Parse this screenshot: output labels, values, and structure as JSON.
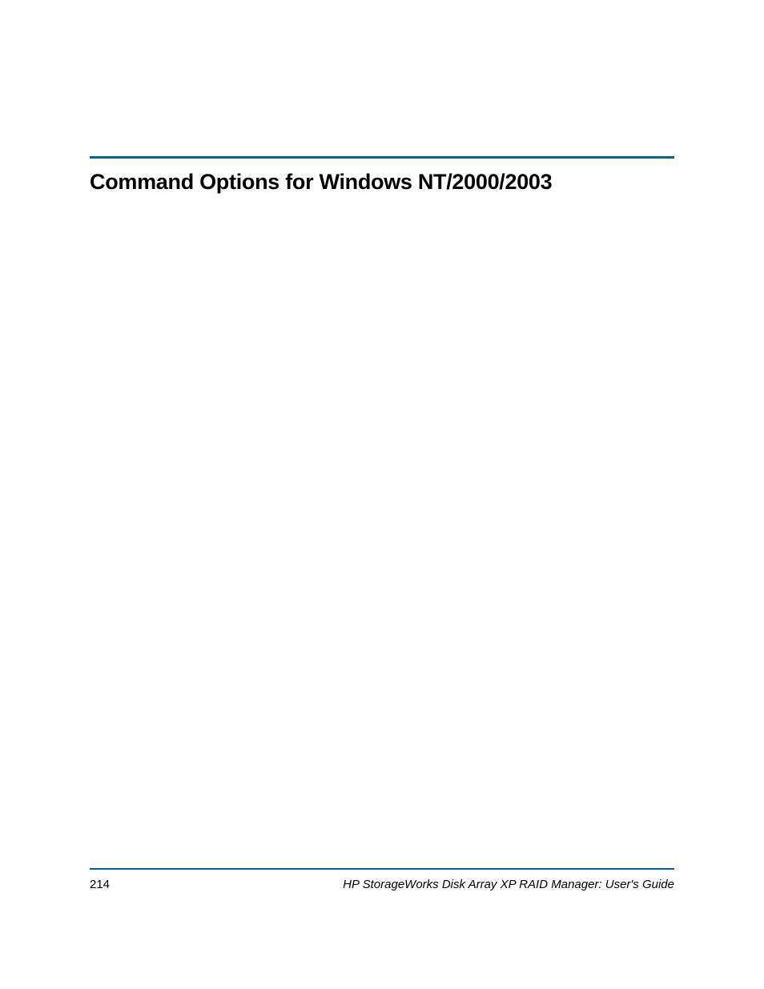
{
  "colors": {
    "accent": "#0060a9",
    "text": "#000000"
  },
  "heading": "Command Options for Windows NT/2000/2003",
  "footer": {
    "page_number": "214",
    "doc_title": "HP StorageWorks Disk Array XP RAID Manager: User's Guide"
  }
}
